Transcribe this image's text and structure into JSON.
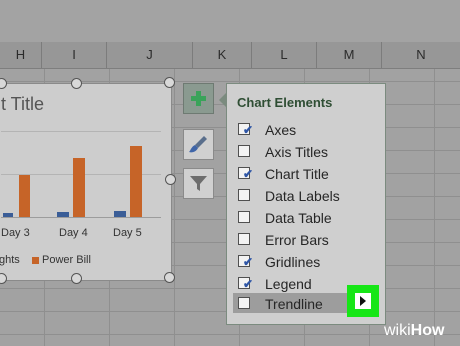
{
  "column_headers": [
    "H",
    "I",
    "J",
    "K",
    "L",
    "M",
    "N"
  ],
  "chart": {
    "title_fragment": "t Title",
    "x_labels": [
      "Day 3",
      "Day 4",
      "Day 5"
    ],
    "legend_fragment": "ghts",
    "legend_power": "Power Bill",
    "series": [
      {
        "name": "Lights (partial)",
        "values": [
          1,
          1,
          1
        ]
      },
      {
        "name": "Power Bill",
        "values": [
          6,
          8,
          10
        ]
      }
    ],
    "colors": {
      "lights": "#3a5d97",
      "power": "#c66428"
    }
  },
  "side_buttons": [
    {
      "name": "chart-elements-button",
      "icon": "plus-icon"
    },
    {
      "name": "chart-styles-button",
      "icon": "paintbrush-icon"
    },
    {
      "name": "chart-filters-button",
      "icon": "filter-icon"
    }
  ],
  "panel": {
    "title": "Chart Elements",
    "items": [
      {
        "label": "Axes",
        "checked": true
      },
      {
        "label": "Axis Titles",
        "checked": false
      },
      {
        "label": "Chart Title",
        "checked": true
      },
      {
        "label": "Data Labels",
        "checked": false
      },
      {
        "label": "Data Table",
        "checked": false
      },
      {
        "label": "Error Bars",
        "checked": false
      },
      {
        "label": "Gridlines",
        "checked": true
      },
      {
        "label": "Legend",
        "checked": true
      },
      {
        "label": "Trendline",
        "checked": false
      }
    ]
  },
  "watermark": {
    "wiki": "wiki",
    "how": "How"
  }
}
